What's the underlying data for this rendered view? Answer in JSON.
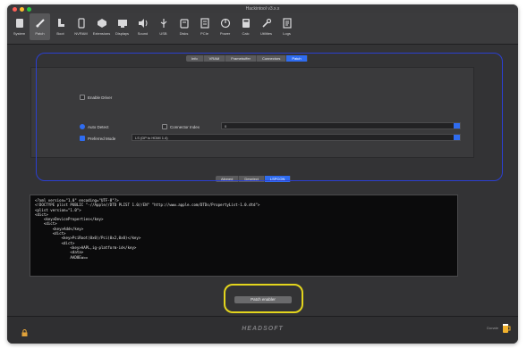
{
  "window": {
    "title": "Hackintool v3.x.x"
  },
  "toolbar": {
    "items": [
      {
        "label": "System"
      },
      {
        "label": "Patch"
      },
      {
        "label": "Boot"
      },
      {
        "label": "NVRAM"
      },
      {
        "label": "Extensions"
      },
      {
        "label": "Displays"
      },
      {
        "label": "Sound"
      },
      {
        "label": "USB"
      },
      {
        "label": "Disks"
      },
      {
        "label": "PCIe"
      },
      {
        "label": "Power"
      },
      {
        "label": "Calc"
      },
      {
        "label": "Utilities"
      },
      {
        "label": "Logs"
      }
    ]
  },
  "top_tabs": [
    "Info",
    "VRAM",
    "Framebuffer",
    "Connectors",
    "Patch"
  ],
  "options": {
    "enable_driver": "Enable Driver",
    "auto_detect": "Auto Detect",
    "connector_index": "Connector Index",
    "connector_value": "0",
    "preferred_mode": "Preferred Mode",
    "preferred_value": "LS (DP to HDMI 1.4)"
  },
  "mid_tabs": [
    "Aligned",
    "Deselect",
    "LSPCON"
  ],
  "code_lines": [
    "<?xml version=\"1.0\" encoding=\"UTF-8\"?>",
    "<!DOCTYPE plist PUBLIC \"-//Apple//DTD PLIST 1.0//EN\" \"http://www.apple.com/DTDs/PropertyList-1.0.dtd\">",
    "<plist version=\"1.0\">",
    "<dict>",
    "    <key>DeviceProperties</key>",
    "    <dict>",
    "        <key>Add</key>",
    "        <dict>",
    "            <key>PciRoot(0x0)/Pci(0x2,0x0)</key>",
    "            <dict>",
    "                <key>AAPL,ig-platform-id</key>",
    "                <data>",
    "                AAD8Ew=="
  ],
  "patch_button": "Patch enabler",
  "bottom": {
    "brand": "HEADSOFT",
    "donate": "Donate"
  },
  "colors": {
    "accent": "#2f6cf0",
    "highlight_blue": "#2b3fd0",
    "highlight_yellow": "#e3d51d"
  },
  "icons": [
    "lock-icon",
    "beer-icon"
  ]
}
